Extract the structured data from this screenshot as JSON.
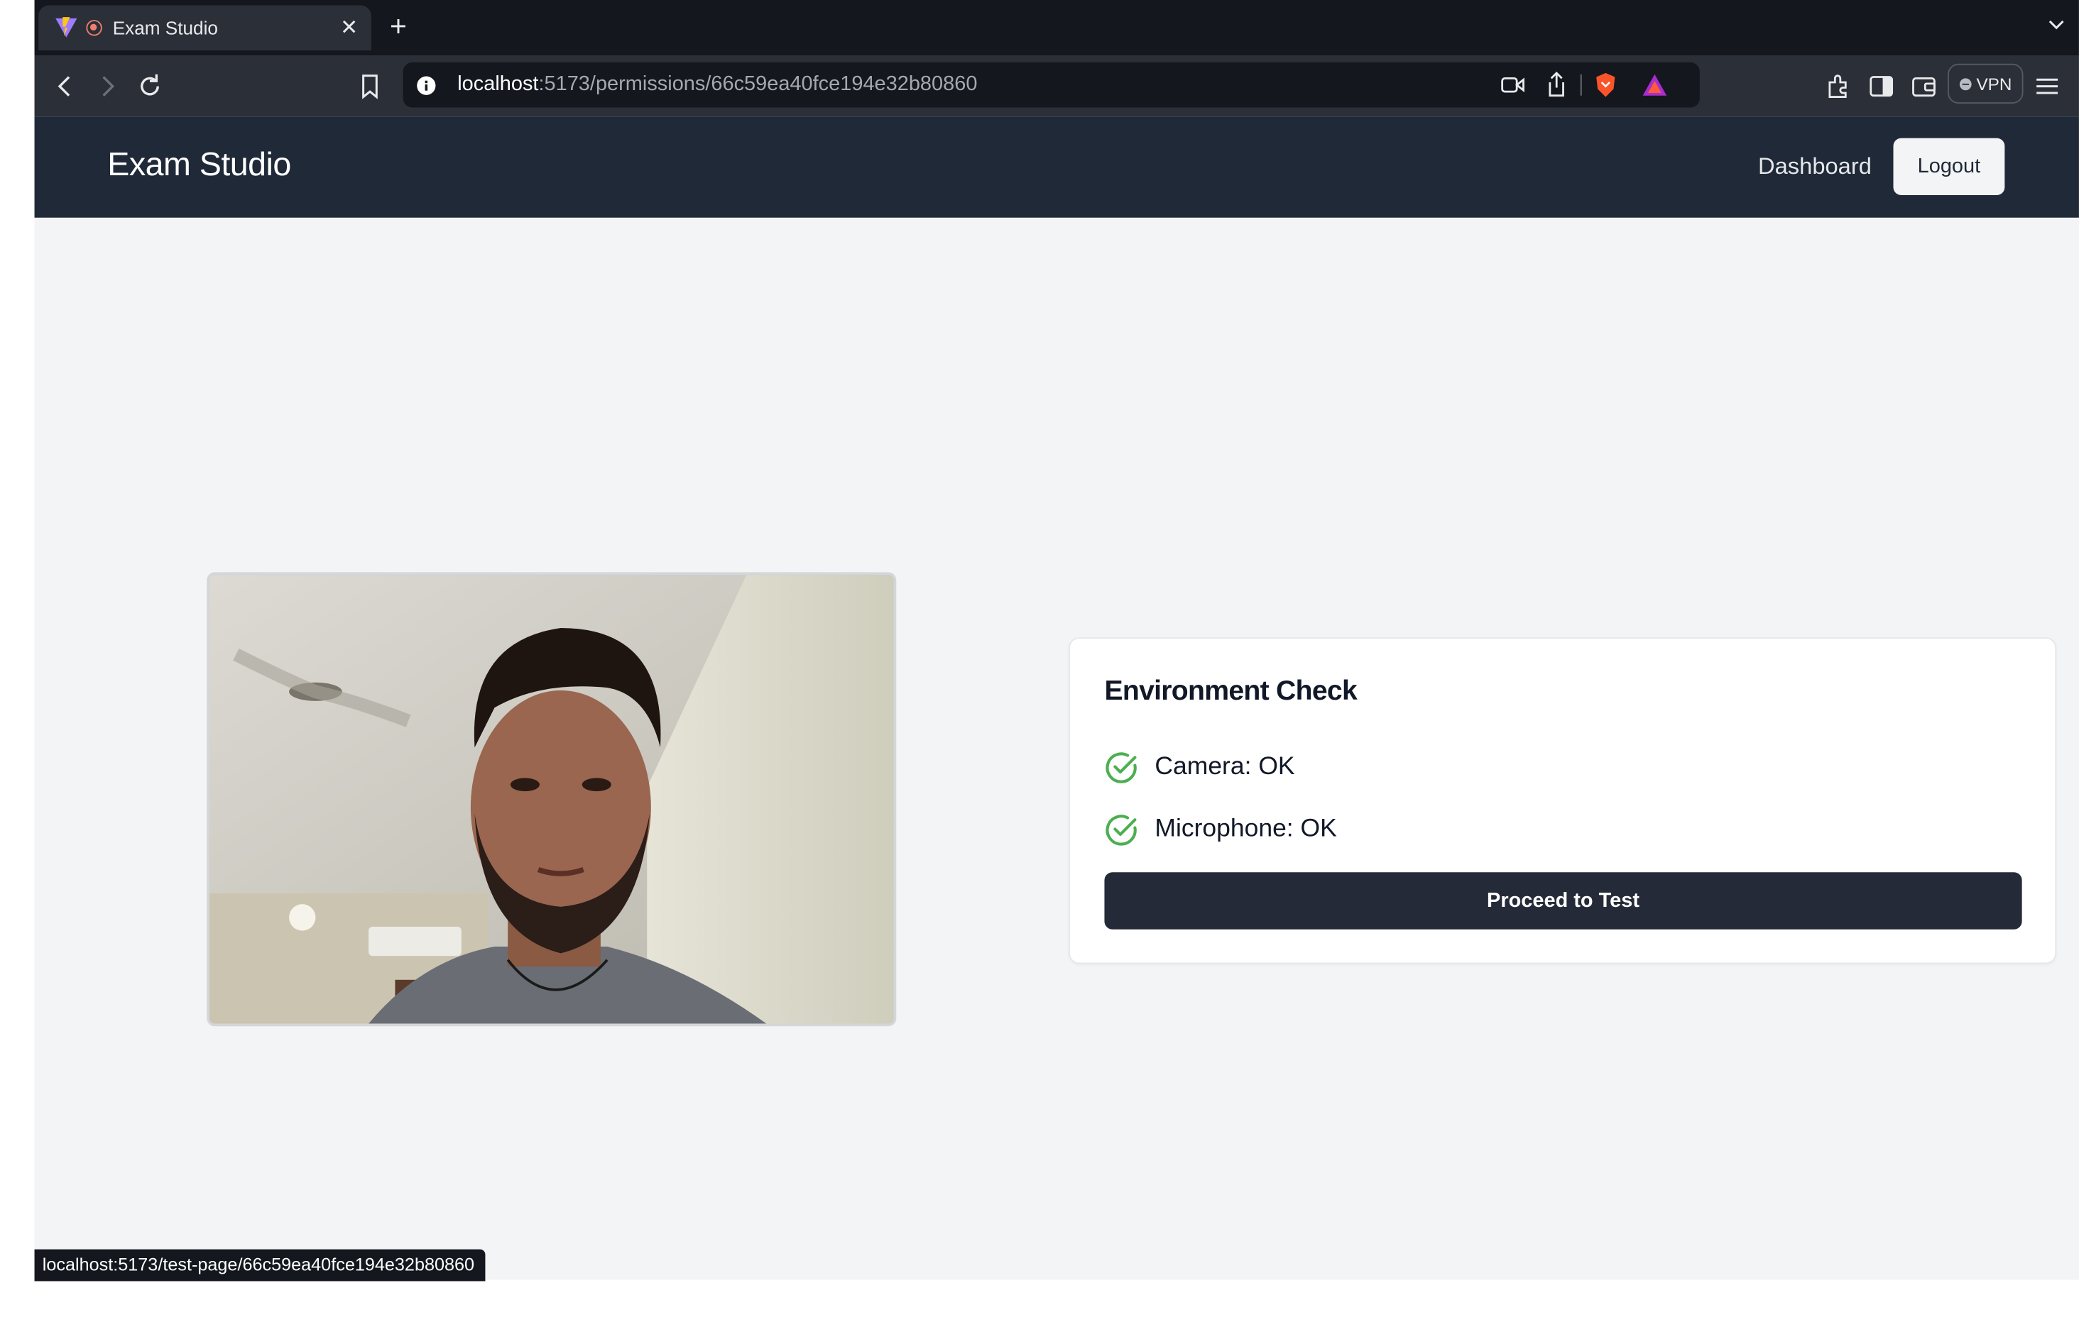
{
  "browser": {
    "tab_title": "Exam Studio",
    "url_host": "localhost",
    "url_path": ":5173/permissions/66c59ea40fce194e32b80860",
    "vpn_label": "VPN",
    "status_url": "localhost:5173/test-page/66c59ea40fce194e32b80860"
  },
  "navbar": {
    "brand": "Exam Studio",
    "dashboard_label": "Dashboard",
    "logout_label": "Logout"
  },
  "environment_check": {
    "title": "Environment Check",
    "checks": [
      {
        "label": "Camera: OK",
        "status": "ok",
        "icon": "check-circle-icon"
      },
      {
        "label": "Microphone: OK",
        "status": "ok",
        "icon": "check-circle-icon"
      }
    ],
    "proceed_label": "Proceed to Test"
  },
  "colors": {
    "navbar_bg": "#1f2937",
    "page_bg": "#f3f4f6",
    "check_green": "#4caf50",
    "primary_button": "#252a38"
  }
}
